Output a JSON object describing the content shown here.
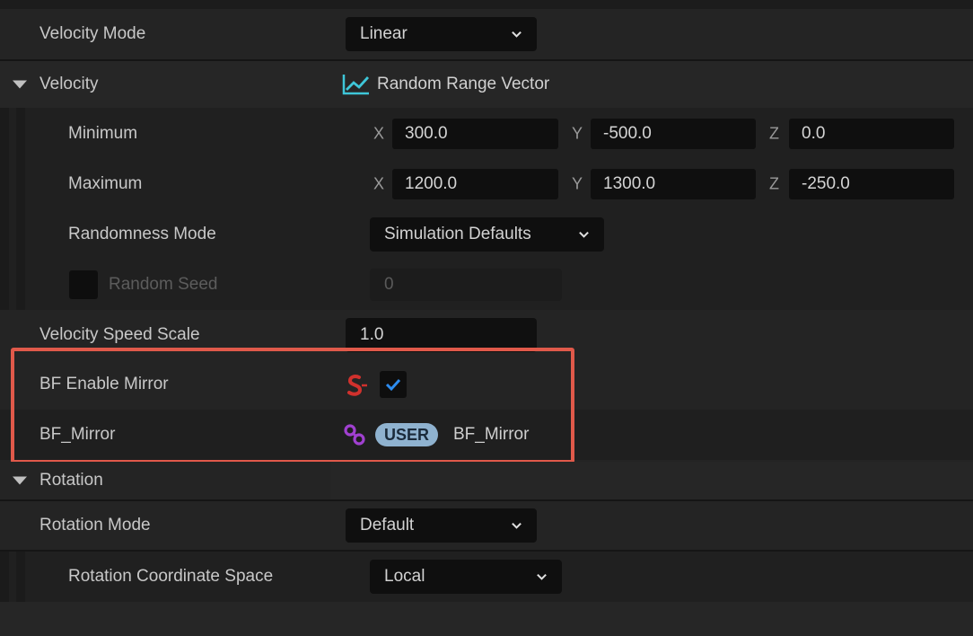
{
  "velocity_mode": {
    "label": "Velocity Mode",
    "value": "Linear"
  },
  "velocity": {
    "label": "Velocity",
    "type_label": "Random Range Vector"
  },
  "minimum": {
    "label": "Minimum",
    "x_axis": "X",
    "x": "300.0",
    "y_axis": "Y",
    "y": "-500.0",
    "z_axis": "Z",
    "z": "0.0"
  },
  "maximum": {
    "label": "Maximum",
    "x_axis": "X",
    "x": "1200.0",
    "y_axis": "Y",
    "y": "1300.0",
    "z_axis": "Z",
    "z": "-250.0"
  },
  "randomness_mode": {
    "label": "Randomness Mode",
    "value": "Simulation Defaults"
  },
  "random_seed": {
    "label": "Random Seed",
    "value": "0",
    "checked": false
  },
  "velocity_speed_scale": {
    "label": "Velocity Speed Scale",
    "value": "1.0"
  },
  "bf_enable_mirror": {
    "label": "BF Enable Mirror",
    "checked": true
  },
  "bf_mirror": {
    "label": "BF_Mirror",
    "badge": "USER",
    "value": "BF_Mirror"
  },
  "rotation": {
    "label": "Rotation"
  },
  "rotation_mode": {
    "label": "Rotation Mode",
    "value": "Default"
  },
  "rotation_coordinate_space": {
    "label": "Rotation Coordinate Space",
    "value": "Local"
  },
  "colors": {
    "highlight": "#e0594a",
    "accent_blue": "#2d8cf0",
    "static_switch": "#d0312d",
    "link_purple": "#a040d0",
    "curve_teal": "#3ec6d8"
  }
}
